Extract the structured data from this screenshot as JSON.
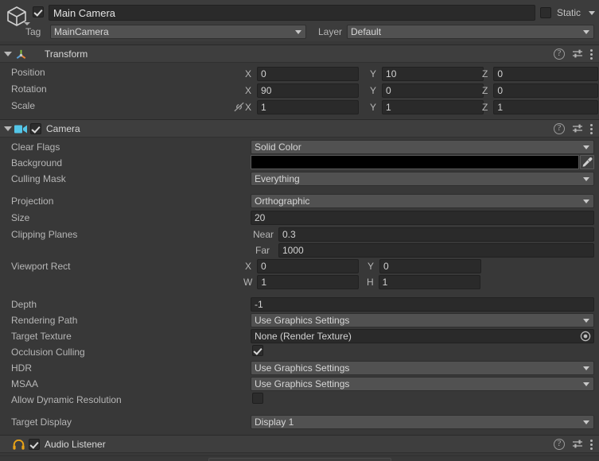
{
  "gameobject": {
    "icon": "cube-prefab-icon",
    "enabled": true,
    "name": "Main Camera",
    "static_label": "Static",
    "static_checked": false,
    "tag_label": "Tag",
    "tag_value": "MainCamera",
    "layer_label": "Layer",
    "layer_value": "Default"
  },
  "transform": {
    "title": "Transform",
    "icon": "transform-gizmo-icon",
    "rows": [
      {
        "label": "Position",
        "x": "0",
        "y": "10",
        "z": "0"
      },
      {
        "label": "Rotation",
        "x": "90",
        "y": "0",
        "z": "0"
      },
      {
        "label": "Scale",
        "x": "1",
        "y": "1",
        "z": "1"
      }
    ],
    "axis_x": "X",
    "axis_y": "Y",
    "axis_z": "Z",
    "scale_link_icon": "link-broken-icon"
  },
  "camera": {
    "title": "Camera",
    "icon": "camera-icon",
    "enabled": true,
    "clear_flags_label": "Clear Flags",
    "clear_flags_value": "Solid Color",
    "background_label": "Background",
    "background_color": "#000000",
    "background_picker_icon": "eyedropper-icon",
    "culling_mask_label": "Culling Mask",
    "culling_mask_value": "Everything",
    "projection_label": "Projection",
    "projection_value": "Orthographic",
    "size_label": "Size",
    "size_value": "20",
    "clipping_planes_label": "Clipping Planes",
    "near_label": "Near",
    "near_value": "0.3",
    "far_label": "Far",
    "far_value": "1000",
    "viewport_rect_label": "Viewport Rect",
    "viewport_x_label": "X",
    "viewport_x_value": "0",
    "viewport_y_label": "Y",
    "viewport_y_value": "0",
    "viewport_w_label": "W",
    "viewport_w_value": "1",
    "viewport_h_label": "H",
    "viewport_h_value": "1",
    "depth_label": "Depth",
    "depth_value": "-1",
    "rendering_path_label": "Rendering Path",
    "rendering_path_value": "Use Graphics Settings",
    "target_texture_label": "Target Texture",
    "target_texture_value": "None (Render Texture)",
    "target_texture_picker_icon": "object-picker-icon",
    "occlusion_culling_label": "Occlusion Culling",
    "occlusion_culling_checked": true,
    "hdr_label": "HDR",
    "hdr_value": "Use Graphics Settings",
    "msaa_label": "MSAA",
    "msaa_value": "Use Graphics Settings",
    "allow_dynamic_resolution_label": "Allow Dynamic Resolution",
    "allow_dynamic_resolution_checked": false,
    "target_display_label": "Target Display",
    "target_display_value": "Display 1"
  },
  "audio_listener": {
    "title": "Audio Listener",
    "icon": "headphones-icon",
    "enabled": true
  },
  "header_icons": {
    "help": "?",
    "help_name": "help-icon",
    "preset_name": "preset-icon",
    "menu_name": "overflow-menu-icon"
  },
  "colors": {
    "panel_bg": "#383838",
    "header_bg": "#3c3c3c",
    "field_bg": "#2a2a2a",
    "popup_bg": "#515151",
    "camera_icon": "#54c6e8",
    "audio_icon": "#e8a317"
  }
}
